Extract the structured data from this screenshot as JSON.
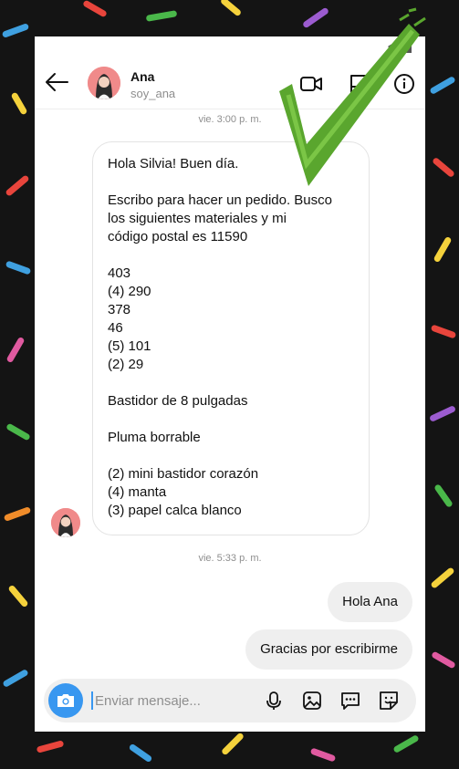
{
  "contact": {
    "name": "Ana",
    "handle": "soy_ana"
  },
  "header_icons": [
    "back-arrow-icon",
    "video-call-icon",
    "flag-icon",
    "info-icon"
  ],
  "timestamps": {
    "first": "vie. 3:00 p. m.",
    "second": "vie. 5:33 p. m."
  },
  "incoming_message": {
    "lines": [
      "Hola Silvia! Buen día.",
      "",
      "Escribo para hacer un pedido. Busco",
      "los siguientes materiales y mi",
      "código postal es 11590",
      "",
      "403",
      "(4) 290",
      "378",
      "46",
      "(5) 101",
      "(2) 29",
      "",
      "Bastidor de 8 pulgadas",
      "",
      "Pluma borrable",
      "",
      "(2) mini bastidor corazón",
      "(4) manta",
      "(3) papel calca blanco"
    ]
  },
  "outgoing_messages": [
    "Hola Ana",
    "Gracias por escribirme"
  ],
  "composer": {
    "placeholder": "Enviar mensaje...",
    "icons": [
      "camera-icon",
      "microphone-icon",
      "gallery-icon",
      "chat-icon",
      "sticker-icon"
    ]
  },
  "colors": {
    "accent": "#3897f0",
    "bubble_out": "#efefef",
    "checkmark": "#5aa62e",
    "avatar": "#f08a8a"
  }
}
